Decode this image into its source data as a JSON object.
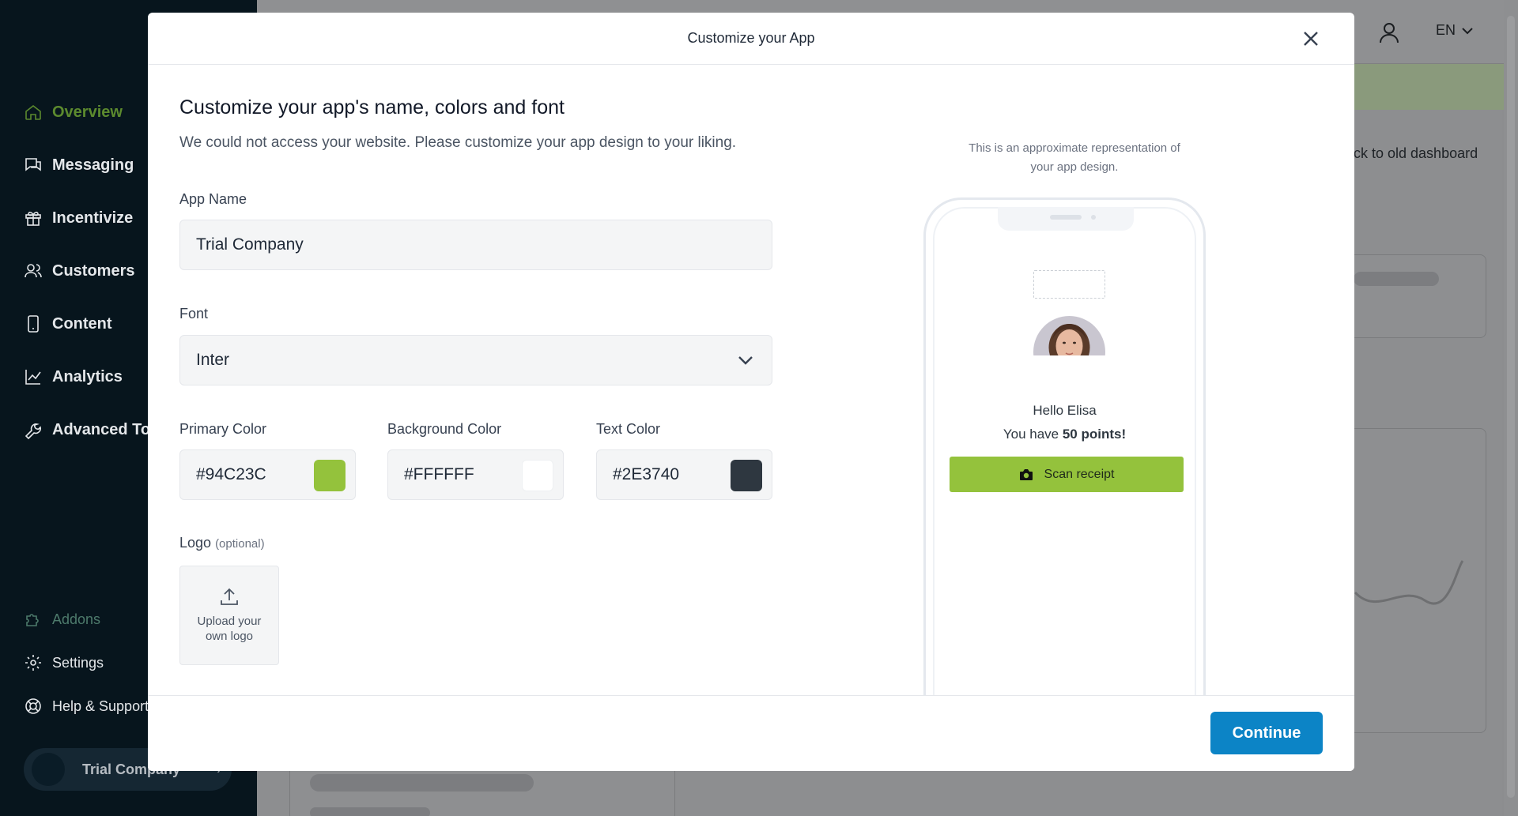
{
  "sidebar": {
    "items": [
      {
        "label": "Overview",
        "icon": "home-icon"
      },
      {
        "label": "Messaging",
        "icon": "chat-icon"
      },
      {
        "label": "Incentivize",
        "icon": "gift-icon"
      },
      {
        "label": "Customers",
        "icon": "users-icon"
      },
      {
        "label": "Content",
        "icon": "phone-icon"
      },
      {
        "label": "Analytics",
        "icon": "chart-icon"
      },
      {
        "label": "Advanced To",
        "icon": "wrench-icon"
      }
    ],
    "bottom_items": [
      {
        "label": "Addons",
        "icon": "puzzle-icon"
      },
      {
        "label": "Settings",
        "icon": "gear-icon"
      },
      {
        "label": "Help & Support",
        "icon": "lifebuoy-icon"
      }
    ],
    "company": "Trial Company"
  },
  "topbar": {
    "language": "EN"
  },
  "background": {
    "old_dashboard_link": "ck to old dashboard"
  },
  "modal": {
    "title": "Customize your App",
    "heading": "Customize your app's name, colors and font",
    "subheading": "We could not access your website. Please customize your app design to your liking.",
    "app_name": {
      "label": "App Name",
      "value": "Trial Company"
    },
    "font": {
      "label": "Font",
      "value": "Inter"
    },
    "primary_color": {
      "label": "Primary Color",
      "value": "#94C23C"
    },
    "background_color": {
      "label": "Background Color",
      "value": "#FFFFFF"
    },
    "text_color": {
      "label": "Text Color",
      "value": "#2E3740"
    },
    "logo": {
      "label": "Logo",
      "optional": "(optional)",
      "upload_line1": "Upload your",
      "upload_line2": "own logo"
    },
    "preview": {
      "note_line1": "This is an approximate representation of",
      "note_line2": "your app design.",
      "greeting": "Hello Elisa",
      "points_prefix": "You have ",
      "points_value": "50 points!",
      "scan_button": "Scan receipt"
    },
    "continue_label": "Continue"
  },
  "colors": {
    "primary": "#94C23C",
    "background": "#FFFFFF",
    "text": "#2E3740",
    "button_accent": "#0C84C6",
    "sidebar_bg": "#07151D"
  }
}
